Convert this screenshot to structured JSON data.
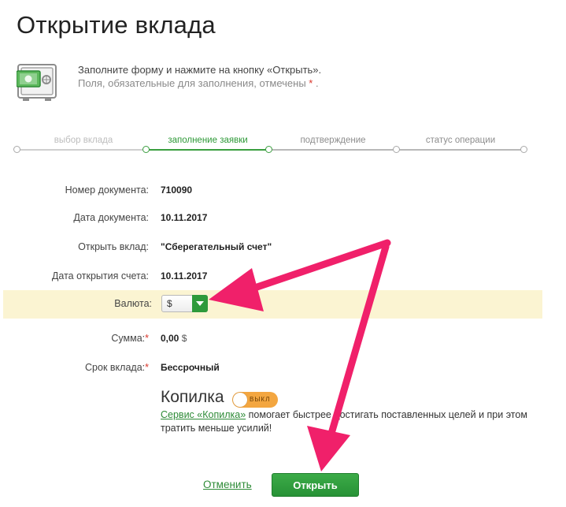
{
  "page": {
    "title": "Открытие вклада"
  },
  "intro": {
    "main": "Заполните форму и нажмите на кнопку «Открыть».",
    "note": "Поля, обязательные для заполнения, отмечены",
    "required_mark": "*",
    "note_end": "."
  },
  "steps": [
    {
      "label": "выбор вклада",
      "state": "done"
    },
    {
      "label": "заполнение заявки",
      "state": "active"
    },
    {
      "label": "подтверждение",
      "state": "pending"
    },
    {
      "label": "статус операции",
      "state": "pending"
    }
  ],
  "form": {
    "document_number": {
      "label": "Номер документа:",
      "value": "710090"
    },
    "document_date": {
      "label": "Дата документа:",
      "value": "10.11.2017"
    },
    "deposit": {
      "label": "Открыть вклад:",
      "value": "\"Сберегательный счет\""
    },
    "opening_date": {
      "label": "Дата открытия счета:",
      "value": "10.11.2017"
    },
    "currency": {
      "label": "Валюта:",
      "selected": "$"
    },
    "amount": {
      "label": "Сумма:",
      "required_mark": "*",
      "value": "0,00",
      "unit": "$"
    },
    "term": {
      "label": "Срок вклада:",
      "required_mark": "*",
      "value": "Бессрочный"
    }
  },
  "piggy": {
    "title": "Копилка",
    "toggle_label": "ВЫКЛ",
    "toggle_on": false,
    "link_text": "Сервис «Копилка»",
    "description": " помогает быстрее достигать поставленных целей и при этом тратить меньше усилий!"
  },
  "actions": {
    "cancel_label": "Отменить",
    "open_label": "Открыть"
  },
  "colors": {
    "brand_green": "#2e9a3b",
    "highlight_row": "#fbf4d2",
    "annotation_arrow": "#f0206a",
    "toggle_off": "#f3a640"
  }
}
